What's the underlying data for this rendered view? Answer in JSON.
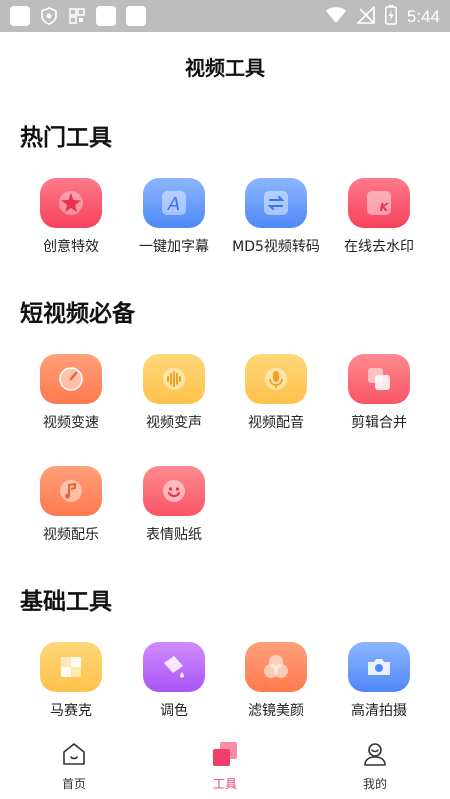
{
  "status_bar": {
    "time": "5:44"
  },
  "header": {
    "title": "视频工具"
  },
  "sections": [
    {
      "title": "热门工具",
      "tools": [
        {
          "label": "创意特效",
          "icon": "sparkle-star-icon",
          "color": "#f6415c"
        },
        {
          "label": "一键加字幕",
          "icon": "letter-a-icon",
          "color": "#4f87f6"
        },
        {
          "label": "MD5视频转码",
          "icon": "swap-arrows-icon",
          "color": "#4f87f6"
        },
        {
          "label": "在线去水印",
          "icon": "watermark-k-icon",
          "color": "#f6415c"
        }
      ]
    },
    {
      "title": "短视频必备",
      "tools": [
        {
          "label": "视频变速",
          "icon": "speedometer-icon",
          "color": "#ff7a4e"
        },
        {
          "label": "视频变声",
          "icon": "sound-wave-icon",
          "color": "#ffc14a"
        },
        {
          "label": "视频配音",
          "icon": "microphone-icon",
          "color": "#ffc14a"
        },
        {
          "label": "剪辑合并",
          "icon": "overlap-squares-icon",
          "color": "#f95566"
        },
        {
          "label": "视频配乐",
          "icon": "music-note-icon",
          "color": "#ff7a4e"
        },
        {
          "label": "表情贴纸",
          "icon": "smiley-face-icon",
          "color": "#f95566"
        }
      ]
    },
    {
      "title": "基础工具",
      "tools": [
        {
          "label": "马赛克",
          "icon": "mosaic-icon",
          "color": "#ffc14a"
        },
        {
          "label": "调色",
          "icon": "paint-bucket-icon",
          "color": "#a955f6"
        },
        {
          "label": "滤镜美颜",
          "icon": "filter-circles-icon",
          "color": "#ff7a4e"
        },
        {
          "label": "高清拍摄",
          "icon": "camera-icon",
          "color": "#4f87f6"
        }
      ]
    }
  ],
  "bottom_nav": [
    {
      "label": "首页",
      "icon": "home-icon",
      "active": false
    },
    {
      "label": "工具",
      "icon": "tools-cards-icon",
      "active": true,
      "active_color": "#f0406a"
    },
    {
      "label": "我的",
      "icon": "profile-icon",
      "active": false
    }
  ]
}
